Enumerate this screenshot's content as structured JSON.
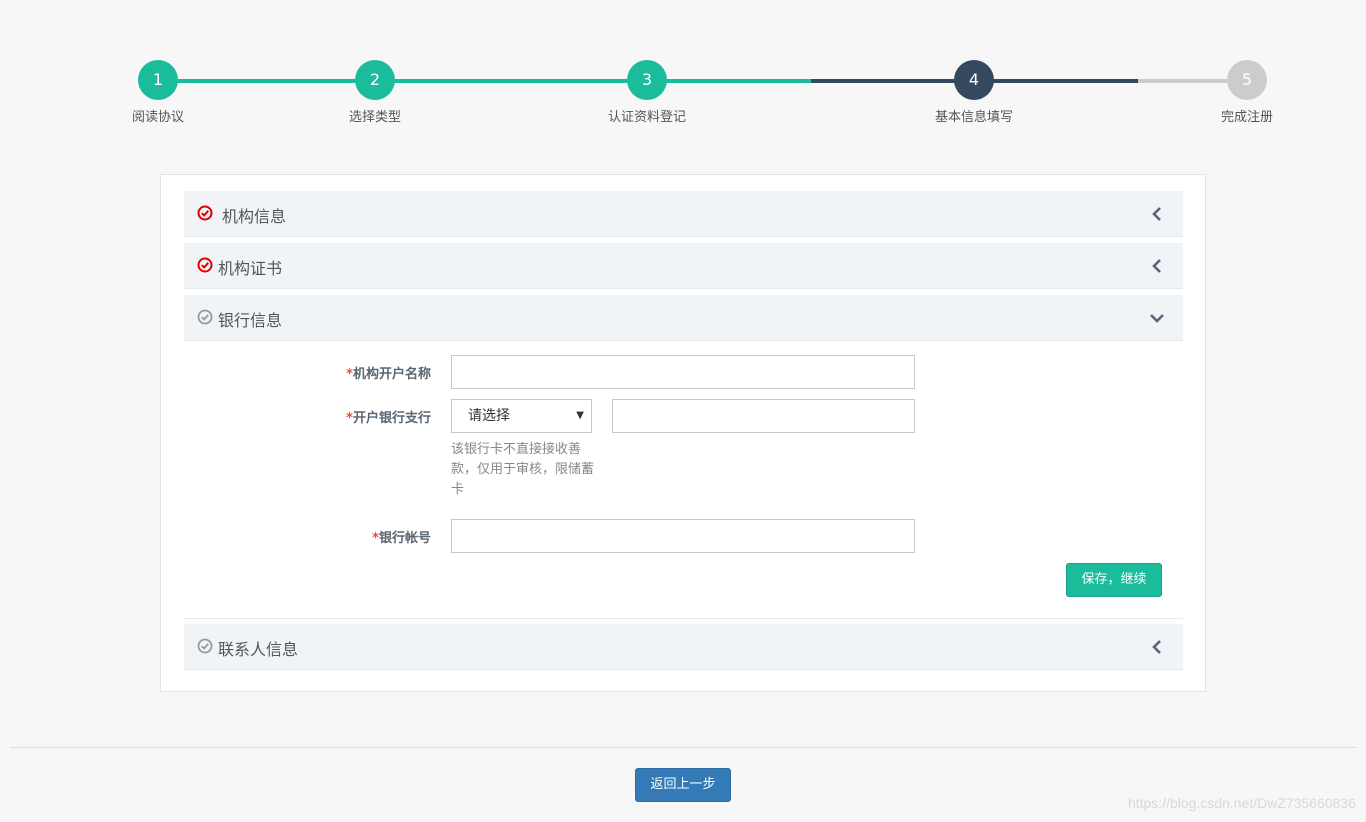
{
  "stepper": {
    "steps": [
      {
        "number": "1",
        "label": "阅读协议",
        "state": "done"
      },
      {
        "number": "2",
        "label": "选择类型",
        "state": "done"
      },
      {
        "number": "3",
        "label": "认证资料登记",
        "state": "done"
      },
      {
        "number": "4",
        "label": "基本信息填写",
        "state": "current"
      },
      {
        "number": "5",
        "label": "完成注册",
        "state": "todo"
      }
    ],
    "colors": {
      "done": "#1abc9c",
      "current": "#34495e",
      "todo": "#cccccc"
    }
  },
  "panels": [
    {
      "title": "机构信息",
      "status": "complete",
      "status_icon": "check-circle-red-icon",
      "toggle_icon": "chevron-left-icon"
    },
    {
      "title": "机构证书",
      "status": "complete",
      "status_icon": "check-circle-red-icon",
      "toggle_icon": "chevron-left-icon"
    },
    {
      "title": "银行信息",
      "status": "pending",
      "status_icon": "check-circle-gray-icon",
      "toggle_icon": "chevron-down-icon"
    },
    {
      "title": "联系人信息",
      "status": "pending",
      "status_icon": "check-circle-gray-icon",
      "toggle_icon": "chevron-left-icon"
    }
  ],
  "bank_form": {
    "account_name": {
      "required_mark": "*",
      "label": "机构开户名称",
      "value": ""
    },
    "bank_branch": {
      "required_mark": "*",
      "label": "开户银行支行",
      "select_value": "请选择",
      "input_value": "",
      "hint": "该银行卡不直接接收善款，仅用于审核，限储蓄卡"
    },
    "account_number": {
      "required_mark": "*",
      "label": "银行帐号",
      "value": ""
    },
    "save_button": "保存，继续"
  },
  "footer": {
    "back_button": "返回上一步",
    "watermark": "https://blog.csdn.net/DwZ735660836"
  },
  "colors": {
    "accent": "#1abc9c",
    "primary": "#337ab7",
    "required": "#e74c3c",
    "complete_icon": "#e00000"
  }
}
